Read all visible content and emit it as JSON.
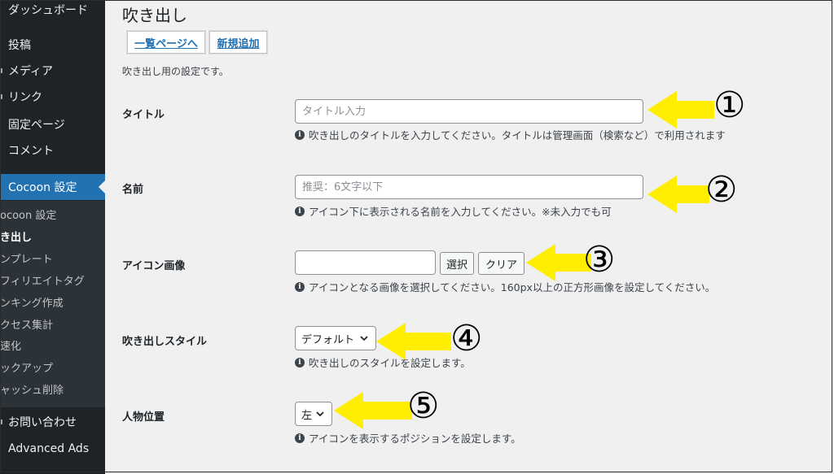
{
  "sidebar": {
    "items": [
      {
        "label": "ダッシュボード"
      },
      {
        "label": "投稿"
      },
      {
        "label": "メディア"
      },
      {
        "label": "リンク"
      },
      {
        "label": "固定ページ"
      },
      {
        "label": "コメント"
      },
      {
        "label": "Cocoon 設定"
      },
      {
        "label": "お問い合わせ"
      },
      {
        "label": "Advanced Ads"
      }
    ],
    "submenu": [
      {
        "label": "ocoon 設定"
      },
      {
        "label": "き出し"
      },
      {
        "label": "ンプレート"
      },
      {
        "label": "フィリエイトタグ"
      },
      {
        "label": "ンキング作成"
      },
      {
        "label": "クセス集計"
      },
      {
        "label": "速化"
      },
      {
        "label": "ックアップ"
      },
      {
        "label": "ャッシュ削除"
      }
    ]
  },
  "page": {
    "title": "吹き出し",
    "list_button": "一覧ページへ",
    "new_button": "新規追加",
    "description": "吹き出し用の設定です。"
  },
  "form": {
    "title": {
      "label": "タイトル",
      "placeholder": "タイトル入力",
      "hint": "吹き出しのタイトルを入力してください。タイトルは管理画面（検索など）で利用されます"
    },
    "name": {
      "label": "名前",
      "placeholder": "推奨：6文字以下",
      "hint": "アイコン下に表示される名前を入力してください。※未入力でも可"
    },
    "icon": {
      "label": "アイコン画像",
      "value": "",
      "select_button": "選択",
      "clear_button": "クリア",
      "hint": "アイコンとなる画像を選択してください。160px以上の正方形画像を設定してください。"
    },
    "style": {
      "label": "吹き出しスタイル",
      "selected": "デフォルト",
      "hint": "吹き出しのスタイルを設定します。"
    },
    "position": {
      "label": "人物位置",
      "selected": "左",
      "hint": "アイコンを表示するポジションを設定します。"
    }
  },
  "annotations": {
    "arrow_color": "#ffee00",
    "numbers": [
      "①",
      "②",
      "③",
      "④",
      "⑤"
    ]
  },
  "colors": {
    "sidebar_bg": "#1d2327",
    "submenu_bg": "#2c3338",
    "active_bg": "#2271b1",
    "page_bg": "#f0f0f1"
  }
}
